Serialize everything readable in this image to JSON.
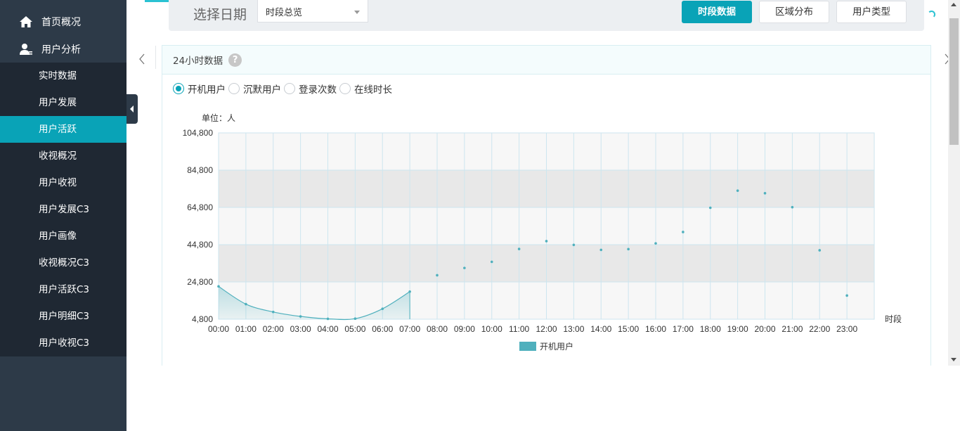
{
  "sidebar": {
    "main_items": [
      {
        "label": "首页概况",
        "icon": "home-icon"
      },
      {
        "label": "用户分析",
        "icon": "user-icon"
      }
    ],
    "sub_items": [
      {
        "label": "实时数据",
        "active": false
      },
      {
        "label": "用户发展",
        "active": false
      },
      {
        "label": "用户活跃",
        "active": true
      },
      {
        "label": "收视概况",
        "active": false
      },
      {
        "label": "用户收视",
        "active": false
      },
      {
        "label": "用户发展C3",
        "active": false
      },
      {
        "label": "用户画像",
        "active": false
      },
      {
        "label": "收视概况C3",
        "active": false
      },
      {
        "label": "用户活跃C3",
        "active": false
      },
      {
        "label": "用户明细C3",
        "active": false
      },
      {
        "label": "用户收视C3",
        "active": false
      }
    ]
  },
  "toolbar": {
    "date_label": "选择日期",
    "select_value": "时段总览",
    "buttons": [
      {
        "label": "时段数据",
        "active": true
      },
      {
        "label": "区域分布",
        "active": false
      },
      {
        "label": "用户类型",
        "active": false
      }
    ]
  },
  "panel": {
    "title": "24小时数据",
    "help_glyph": "?",
    "radios": [
      {
        "label": "开机用户",
        "checked": true
      },
      {
        "label": "沉默用户",
        "checked": false
      },
      {
        "label": "登录次数",
        "checked": false
      },
      {
        "label": "在线时长",
        "checked": false
      }
    ]
  },
  "colors": {
    "accent": "#09a3b7",
    "sidebar": "#2d3a48",
    "submenu": "#1f2833",
    "series": "#4fb0bd"
  },
  "chart_data": {
    "type": "area",
    "unit_label": "单位：人",
    "xlabel": "时段",
    "categories": [
      "00:00",
      "01:00",
      "02:00",
      "03:00",
      "04:00",
      "05:00",
      "06:00",
      "07:00",
      "08:00",
      "09:00",
      "10:00",
      "11:00",
      "12:00",
      "13:00",
      "14:00",
      "15:00",
      "16:00",
      "17:00",
      "18:00",
      "19:00",
      "20:00",
      "21:00",
      "22:00",
      "23:00"
    ],
    "series": [
      {
        "name": "开机用户",
        "values": [
          22400,
          12900,
          8700,
          6300,
          5000,
          5100,
          10400,
          19600,
          28400,
          32300,
          35600,
          42500,
          46700,
          44700,
          42000,
          42400,
          45500,
          51600,
          64600,
          73800,
          72400,
          64900,
          41800,
          17500
        ]
      }
    ],
    "area_range": [
      "00:00",
      "07:00"
    ],
    "ylim": [
      4800,
      104800
    ],
    "yticks": [
      4800,
      24800,
      44800,
      64800,
      84800,
      104800
    ],
    "ytick_labels": [
      "4,800",
      "24,800",
      "44,800",
      "64,800",
      "84,800",
      "104,800"
    ],
    "legend": {
      "label": "开机用户",
      "position": "bottom-center"
    },
    "grid": true
  }
}
